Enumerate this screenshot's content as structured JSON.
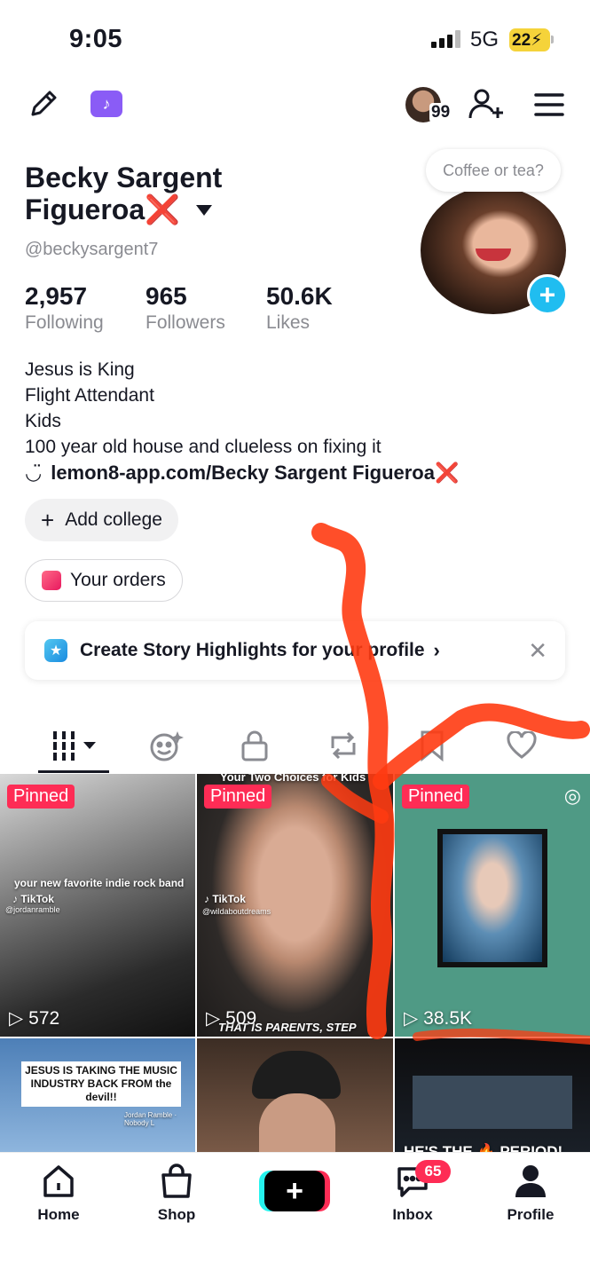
{
  "status_bar": {
    "time": "9:05",
    "network": "5G",
    "battery": "22"
  },
  "top_nav": {
    "friends_count": "99",
    "tiktok_badge": "♪"
  },
  "profile": {
    "name_line1": "Becky Sargent",
    "name_line2": "Figueroa",
    "name_emoji": "❌",
    "handle": "@beckysargent7",
    "avatar_prompt": "Coffee or tea?",
    "stats": [
      {
        "value": "2,957",
        "label": "Following"
      },
      {
        "value": "965",
        "label": "Followers"
      },
      {
        "value": "50.6K",
        "label": "Likes"
      }
    ],
    "bio": [
      "Jesus is King",
      "Flight Attendant",
      "Kids",
      "100 year old house and clueless on fixing it"
    ],
    "link": "lemon8-app.com/Becky Sargent Figueroa",
    "link_emoji": "❌",
    "link_icon": "◡̈",
    "add_college": "Add college",
    "your_orders": "Your orders",
    "highlights_prompt": "Create Story Highlights for your profile"
  },
  "tabs": [
    "videos-grid",
    "reposts-face",
    "private-lock",
    "repost",
    "saved-bookmark",
    "liked-heart"
  ],
  "videos": [
    {
      "pinned": "Pinned",
      "views": "572",
      "caption": "your new favorite indie rock band",
      "tiktok": "♪ TikTok",
      "user": "@jordanramble"
    },
    {
      "pinned": "Pinned",
      "views": "509",
      "caption_top": "Your Two Choices for Kids",
      "caption_bottom": "THAT IS PARENTS, STEP",
      "tiktok": "♪ TikTok",
      "user": "@wildaboutdreams"
    },
    {
      "pinned": "Pinned",
      "views": "38.5K"
    },
    {
      "caption": "JESUS IS TAKING THE MUSIC INDUSTRY BACK FROM the devil!!",
      "sub": "Jordan Ramble · Nobody L"
    },
    {
      "caption": ""
    },
    {
      "caption": "HE'S THE 🔥 PERIOD!"
    }
  ],
  "bottom_nav": {
    "home": "Home",
    "shop": "Shop",
    "create": "+",
    "inbox": "Inbox",
    "inbox_badge": "65",
    "profile": "Profile"
  },
  "colors": {
    "accent": "#fe2c55",
    "cyan": "#25f4ee",
    "avatar_plus": "#20bdf0",
    "scribble": "#ff3b12"
  }
}
